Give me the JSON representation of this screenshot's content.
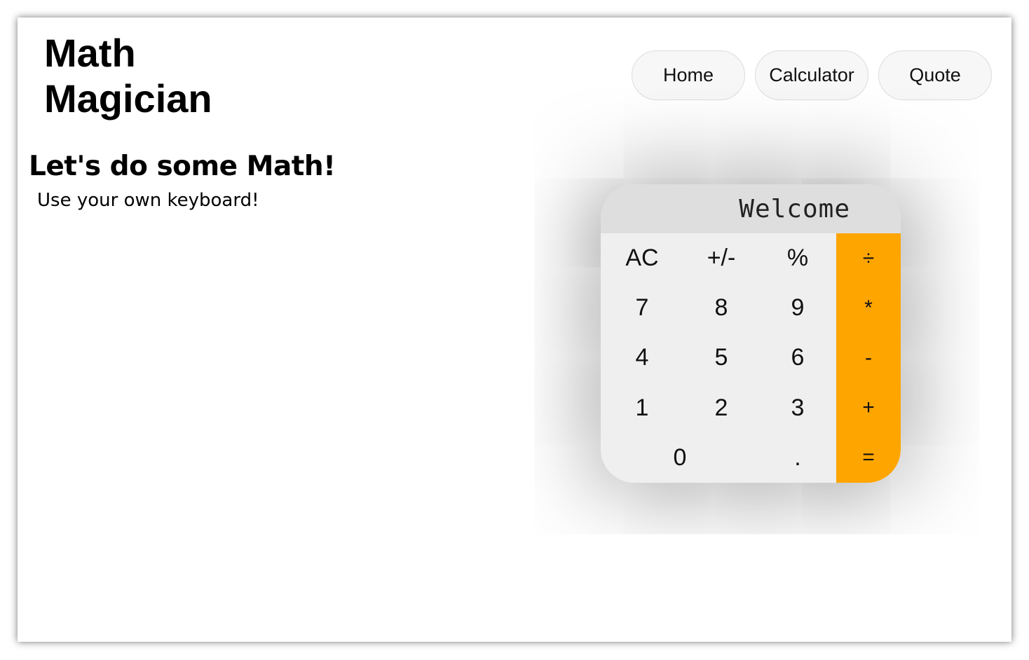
{
  "header": {
    "logo": "Math Magician",
    "nav": [
      "Home",
      "Calculator",
      "Quote"
    ]
  },
  "main": {
    "heading": "Let's do some Math!",
    "subheading": "Use your own keyboard!"
  },
  "calculator": {
    "display": "Welcome",
    "keys": {
      "ac": "AC",
      "sign": "+/-",
      "percent": "%",
      "divide": "÷",
      "seven": "7",
      "eight": "8",
      "nine": "9",
      "multiply": "*",
      "four": "4",
      "five": "5",
      "six": "6",
      "subtract": "-",
      "one": "1",
      "two": "2",
      "three": "3",
      "add": "+",
      "zero": "0",
      "decimal": ".",
      "equals": "="
    },
    "colors": {
      "operator": "#ffa500",
      "key": "#efefef",
      "display": "#dedede"
    }
  }
}
